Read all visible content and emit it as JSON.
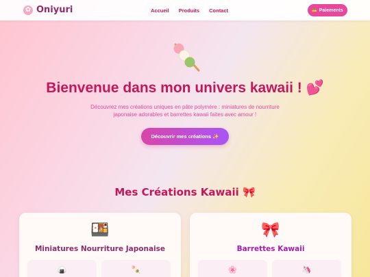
{
  "brand": {
    "name": "Oniyuri",
    "icon": "flower-icon"
  },
  "nav": {
    "links": [
      "Accueil",
      "Produits",
      "Contact"
    ],
    "pay_label": "Paiements",
    "pay_icon": "card-icon"
  },
  "hero": {
    "icon": "dango-icon",
    "title": "Bienvenue dans mon univers kawaii ! 💕",
    "subtitle": "Découvrez mes créations uniques en pâte polymère : miniatures de nourriture japonaise adorables et barrettes kawaii faites avec amour !",
    "cta_label": "Découvrir mes créations ✨"
  },
  "section": {
    "title": "Mes Créations Kawaii 🎀"
  },
  "cards": [
    {
      "title": "Miniatures Nourriture Japonaise",
      "icon": "bento-icon",
      "color": "#8e2b6a",
      "items": [
        "🍙",
        "🍡"
      ]
    },
    {
      "title": "Barrettes Kawaii",
      "icon": "bow-icon",
      "color": "#a21caf",
      "items": [
        "🌸",
        "🦄"
      ]
    }
  ],
  "colors": {
    "accent": "#c2185b",
    "button": "#e8479b",
    "purple": "#a855f7"
  }
}
